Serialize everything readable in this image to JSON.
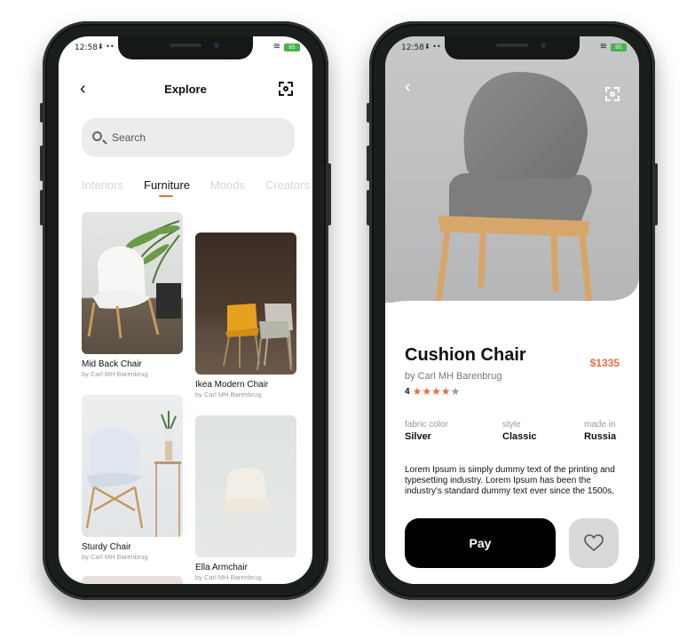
{
  "status": {
    "time": "12:58",
    "extra": "⬇ ••",
    "battery": "95"
  },
  "explore": {
    "title": "Explore",
    "search_placeholder": "Search",
    "tabs": [
      {
        "label": "Interiors",
        "active": false
      },
      {
        "label": "Furniture",
        "active": true
      },
      {
        "label": "Moods",
        "active": false
      },
      {
        "label": "Creators",
        "active": false
      }
    ],
    "cards": [
      {
        "name": "Mid Back Chair",
        "by": "by Carl MH Barenbrug"
      },
      {
        "name": "Ikea Modern Chair",
        "by": "by Carl MH Barenbrug"
      },
      {
        "name": "Sturdy Chair",
        "by": "by Carl MH Barenbrug"
      },
      {
        "name": "Ella Armchair",
        "by": "by Carl MH Barenbrug"
      }
    ]
  },
  "product": {
    "title": "Cushion Chair",
    "price": "$1335",
    "author": "by Carl MH Barenbrug",
    "rating": "4",
    "stars_filled": 4,
    "stars_total": 5,
    "specs": [
      {
        "label": "fabric color",
        "value": "Silver"
      },
      {
        "label": "style",
        "value": "Classic"
      },
      {
        "label": "made in",
        "value": "Russia"
      }
    ],
    "description": "Lorem Ipsum is simply dummy text of the printing and typesetting industry. Lorem Ipsum has been the industry's standard dummy text ever since the 1500s,",
    "pay_label": "Pay"
  },
  "colors": {
    "accent": "#e8703a",
    "pay_button": "#000000",
    "fav_button": "#d9d9d9"
  }
}
